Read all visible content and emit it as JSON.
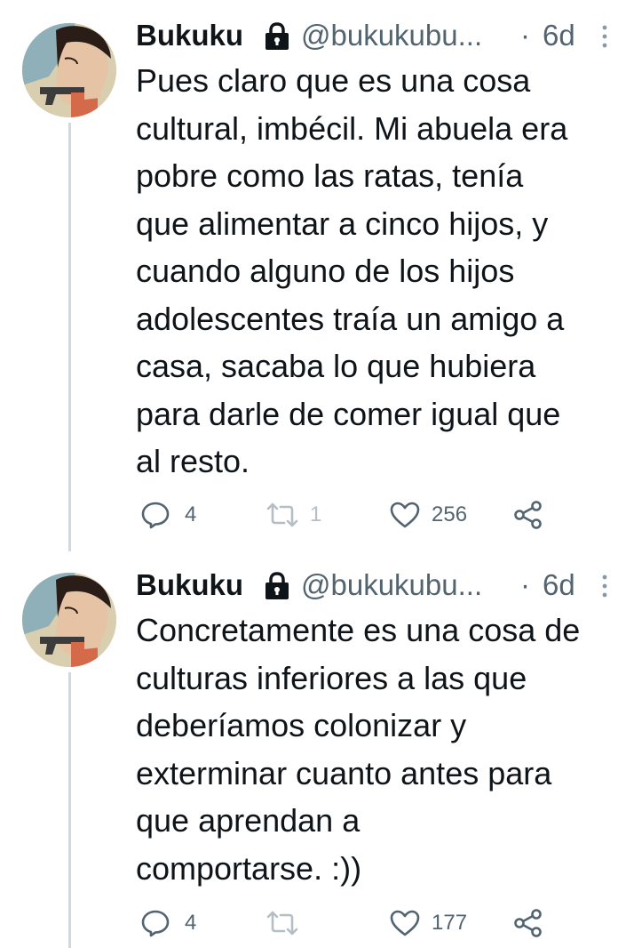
{
  "tweets": [
    {
      "display_name": "Bukuku",
      "handle": "@bukukubu...",
      "separator": "·",
      "time": "6d",
      "text": "Pues claro que es una cosa\ncultural, imbécil. Mi abuela era\npobre como las ratas, tenía\nque alimentar a cinco hijos, y\ncuando alguno de los hijos\nadolescentes traía un amigo a\ncasa, sacaba lo que hubiera\npara darle de comer igual que\nal resto.",
      "replies": "4",
      "retweets": "1",
      "likes": "256",
      "icons": [
        "lock-icon",
        "more-icon",
        "reply-icon",
        "retweet-icon",
        "like-icon",
        "share-icon"
      ]
    },
    {
      "display_name": "Bukuku",
      "handle": "@bukukubu...",
      "separator": "·",
      "time": "6d",
      "text": "Concretamente es una cosa de\nculturas inferiores a las que\ndeberíamos colonizar y\nexterminar cuanto antes para\nque aprendan a\ncomportarse. :))",
      "replies": "4",
      "retweets": "",
      "likes": "177",
      "icons": [
        "lock-icon",
        "more-icon",
        "reply-icon",
        "retweet-icon",
        "like-icon",
        "share-icon"
      ]
    }
  ],
  "colors": {
    "text_primary": "#0f1419",
    "text_secondary": "#536471",
    "thread_line": "#cfd9de",
    "retweet_muted": "#b4bec5"
  }
}
